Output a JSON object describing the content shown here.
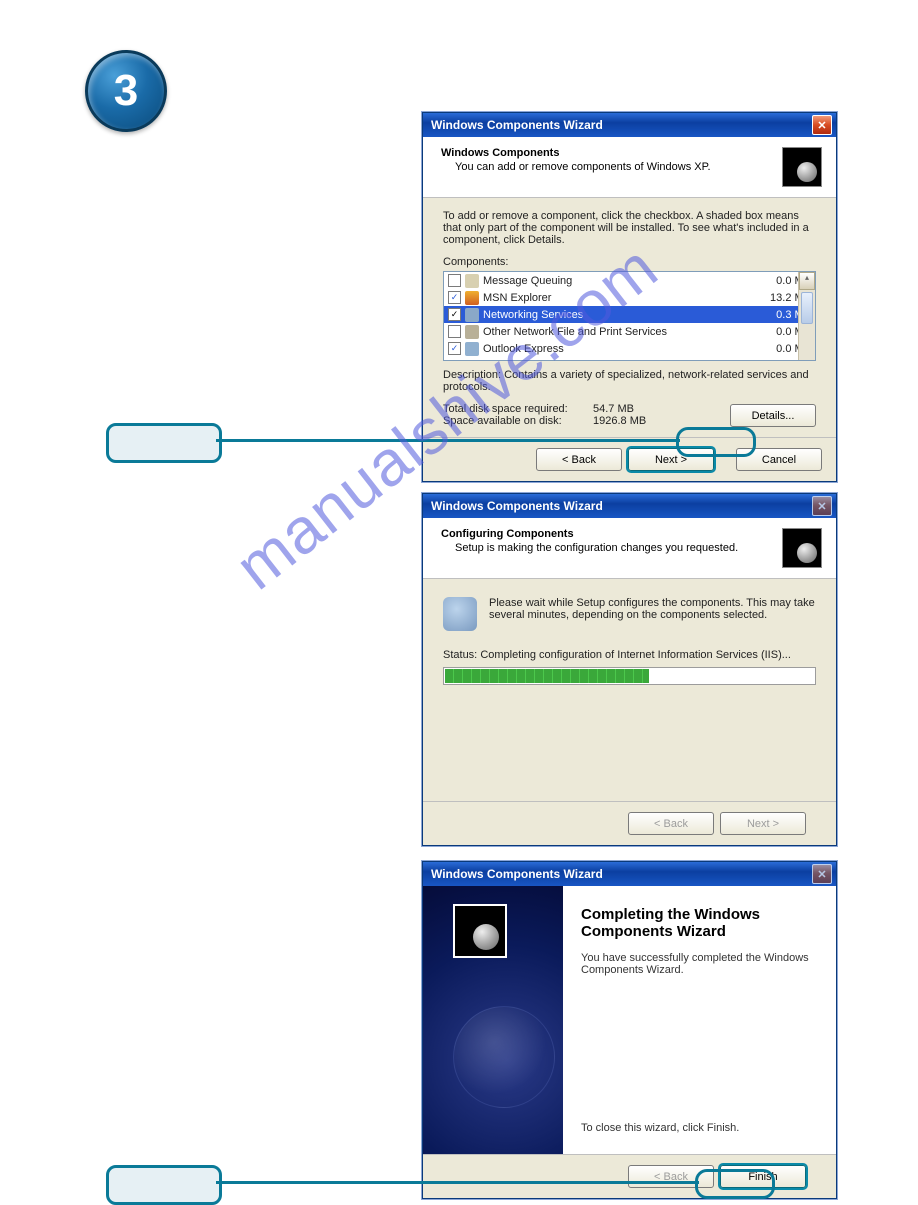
{
  "step_number": "3",
  "watermark": "manualshive.com",
  "callouts": {
    "pill1": "",
    "pill2": ""
  },
  "wizard1": {
    "title": "Windows Components Wizard",
    "heading": "Windows Components",
    "subheading": "You can add or remove components of Windows XP.",
    "instructions": "To add or remove a component, click the checkbox. A shaded box means that only part of the component will be installed. To see what's included in a component, click Details.",
    "components_label": "Components:",
    "components": [
      {
        "checked": false,
        "name": "Message Queuing",
        "size": "0.0 MB"
      },
      {
        "checked": true,
        "name": "MSN Explorer",
        "size": "13.2 MB"
      },
      {
        "checked": true,
        "name": "Networking Services",
        "size": "0.3 MB",
        "selected": true
      },
      {
        "checked": false,
        "name": "Other Network File and Print Services",
        "size": "0.0 MB"
      },
      {
        "checked": true,
        "name": "Outlook Express",
        "size": "0.0 MB"
      }
    ],
    "description_label": "Description:",
    "description_text": "Contains a variety of specialized, network-related services and protocols.",
    "total_label": "Total disk space required:",
    "total_value": "54.7 MB",
    "avail_label": "Space available on disk:",
    "avail_value": "1926.8 MB",
    "details_btn": "Details...",
    "back_btn": "< Back",
    "next_btn": "Next >",
    "cancel_btn": "Cancel"
  },
  "wizard2": {
    "title": "Windows Components Wizard",
    "heading": "Configuring Components",
    "subheading": "Setup is making the configuration changes you requested.",
    "wait_text": "Please wait while Setup configures the components. This may take several minutes, depending on the components selected.",
    "status_label": "Status:",
    "status_text": "Completing configuration of Internet Information Services (IIS)...",
    "back_btn": "< Back",
    "next_btn": "Next >"
  },
  "wizard3": {
    "title": "Windows Components Wizard",
    "heading": "Completing the Windows Components Wizard",
    "body": "You have successfully completed the Windows Components Wizard.",
    "close_hint": "To close this wizard, click Finish.",
    "back_btn": "< Back",
    "finish_btn": "Finish"
  }
}
